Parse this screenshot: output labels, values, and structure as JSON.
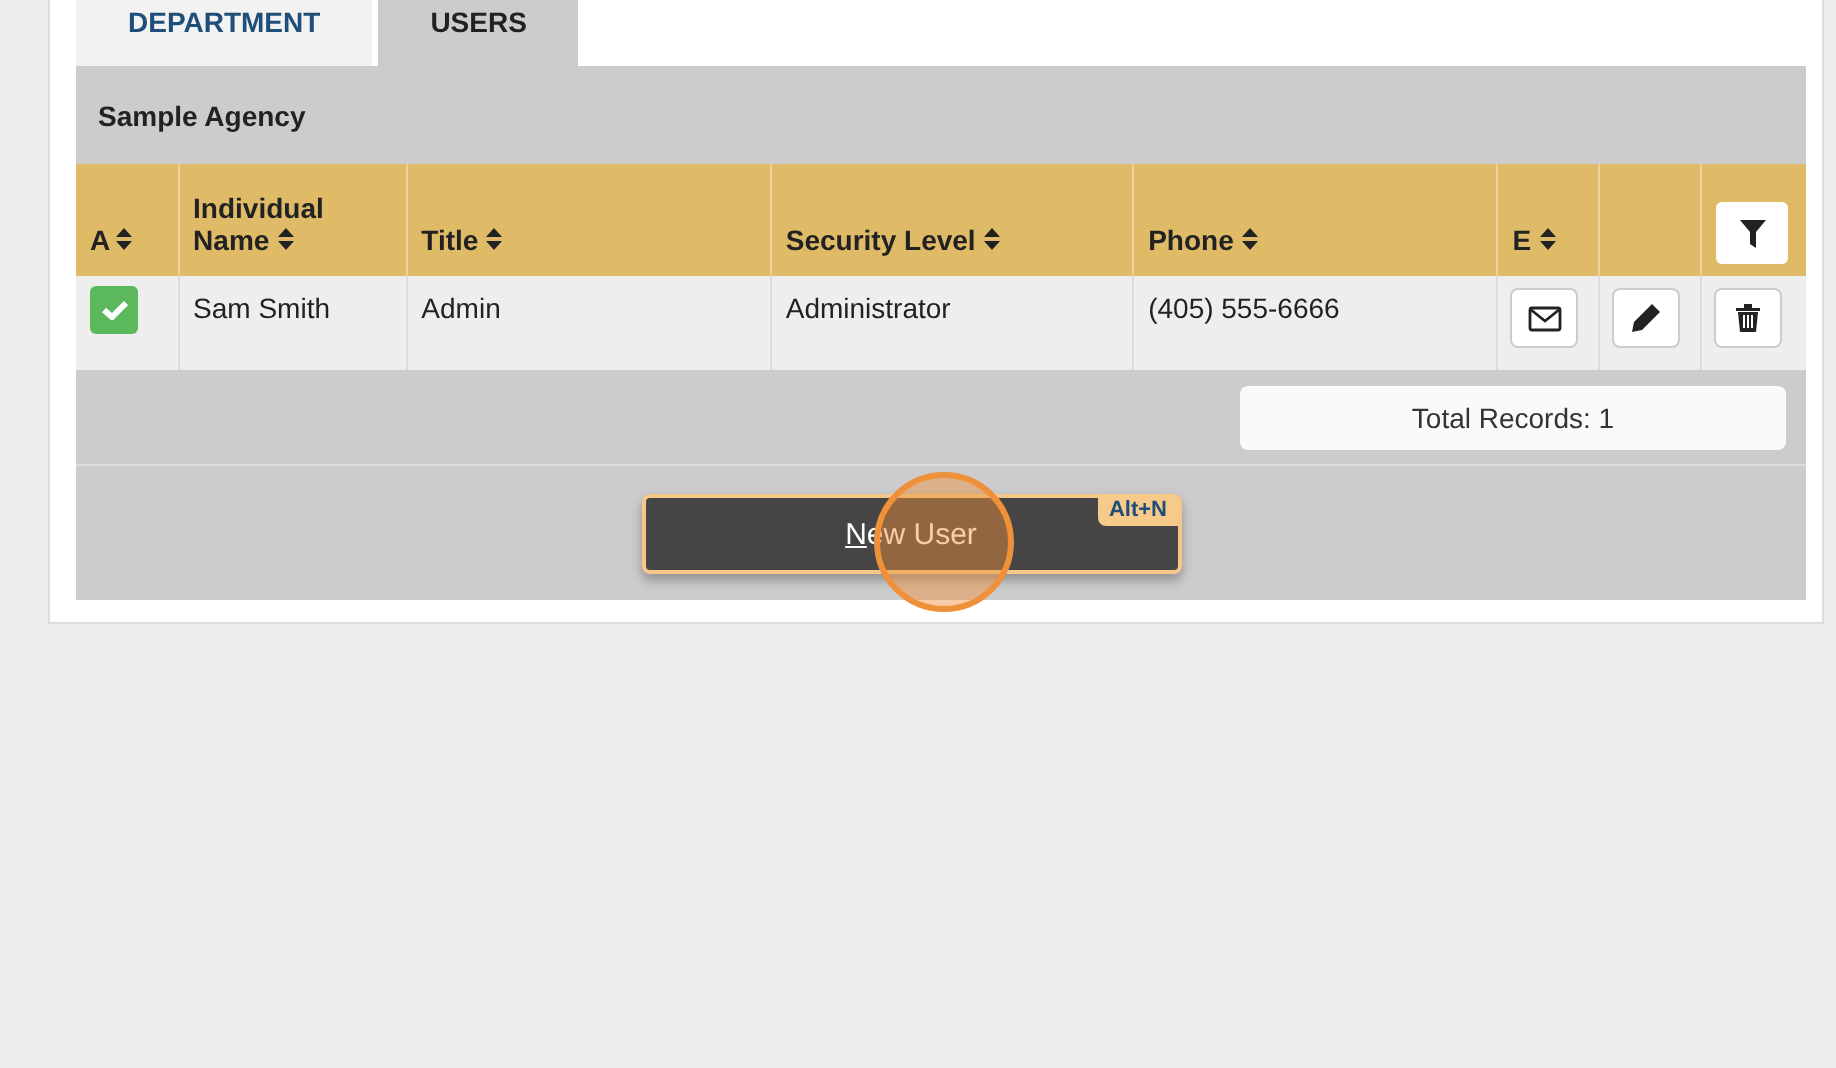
{
  "tabs": [
    {
      "label": "DEPARTMENT",
      "selected": false
    },
    {
      "label": "USERS",
      "selected": true
    }
  ],
  "agency": "Sample Agency",
  "table": {
    "columns": [
      {
        "label": "A",
        "sortable": true
      },
      {
        "label": "Individual Name",
        "sortable": true
      },
      {
        "label": "Title",
        "sortable": true
      },
      {
        "label": "Security Level",
        "sortable": true
      },
      {
        "label": "Phone",
        "sortable": true
      },
      {
        "label": "E",
        "sortable": true
      }
    ],
    "rows": [
      {
        "active": true,
        "name": "Sam Smith",
        "title": "Admin",
        "security_level": "Administrator",
        "phone": "(405) 555-6666"
      }
    ],
    "total": "Total Records: 1"
  },
  "new_button": {
    "label": "New User",
    "shortcut": "Alt+N"
  }
}
